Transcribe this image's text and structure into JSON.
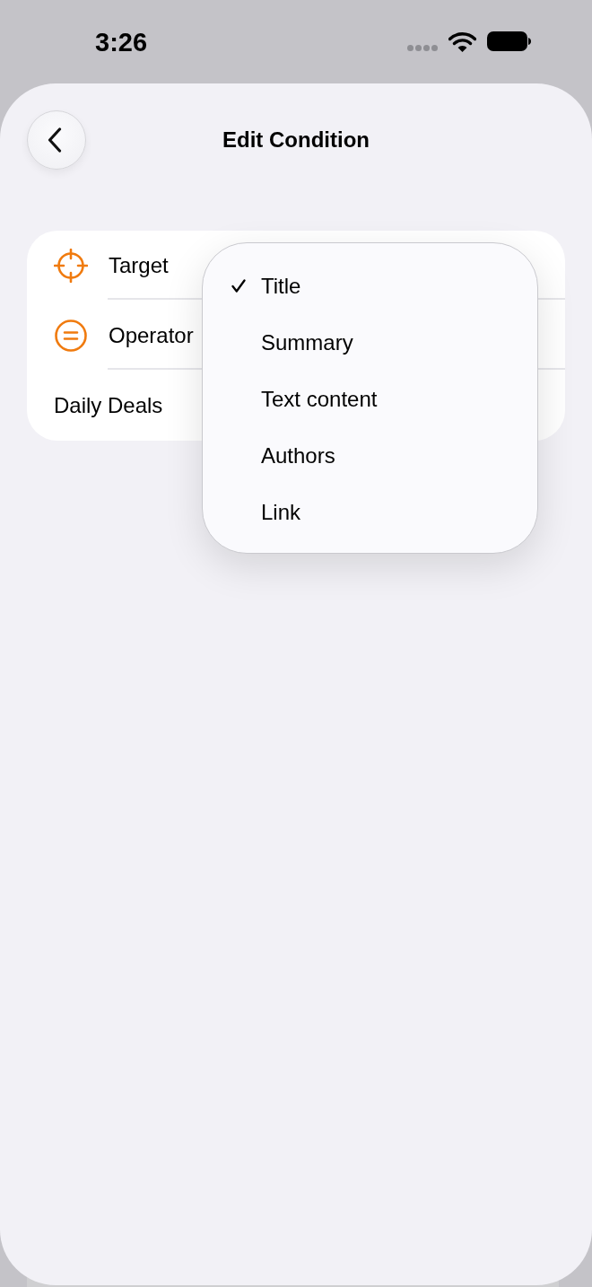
{
  "status_bar": {
    "time": "3:26"
  },
  "header": {
    "title": "Edit Condition"
  },
  "form": {
    "rows": [
      {
        "kind": "target",
        "label": "Target"
      },
      {
        "kind": "operator",
        "label": "Operator"
      },
      {
        "kind": "text",
        "value": "Daily Deals"
      }
    ]
  },
  "menu": {
    "items": [
      {
        "label": "Title",
        "selected": true
      },
      {
        "label": "Summary",
        "selected": false
      },
      {
        "label": "Text content",
        "selected": false
      },
      {
        "label": "Authors",
        "selected": false
      },
      {
        "label": "Link",
        "selected": false
      }
    ]
  }
}
